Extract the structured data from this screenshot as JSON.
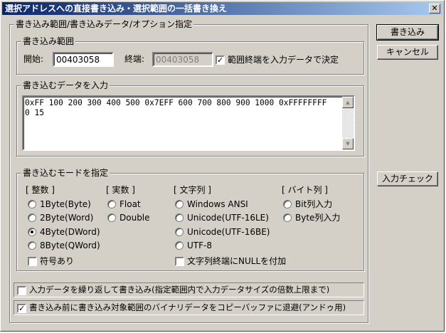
{
  "window": {
    "title": "選択アドレスへの直接書き込み・選択範囲の一括書き換え",
    "close_glyph": "✕"
  },
  "outer_group": {
    "legend": "書き込み範囲/書き込みデータ/オプション指定"
  },
  "range": {
    "legend": "書き込み範囲",
    "start_label": "開始:",
    "start_value": "00403058",
    "end_label": "終端:",
    "end_value": "00403058",
    "auto_end_checked": true,
    "auto_end_label": "範囲終端を入力データで決定"
  },
  "data_input": {
    "legend": "書き込むデータを入力",
    "text": "0xFF 100 200 300 400 500 0x7EFF 600 700 800 900 1000 0xFFFFFFFF\n0 15"
  },
  "mode": {
    "legend": "書き込むモードを指定",
    "integer": {
      "header": "[ 整数 ]",
      "options": [
        "1Byte(Byte)",
        "2Byte(Word)",
        "4Byte(DWord)",
        "8Byte(QWord)"
      ],
      "selected": 2,
      "signed_label": "符号あり",
      "signed_checked": false
    },
    "real": {
      "header": "[ 実数 ]",
      "options": [
        "Float",
        "Double"
      ]
    },
    "string": {
      "header": "[ 文字列 ]",
      "options": [
        "Windows ANSI",
        "Unicode(UTF-16LE)",
        "Unicode(UTF-16BE)",
        "UTF-8"
      ],
      "null_label": "文字列終端にNULLを付加",
      "null_checked": false
    },
    "bytes": {
      "header": "[ バイト列 ]",
      "options": [
        "Bit列入力",
        "Byte列入力"
      ]
    }
  },
  "options": {
    "repeat_label": "入力データを繰り返して書き込み(指定範囲内で入力データサイズの倍数上限まで)",
    "repeat_checked": false,
    "backup_label": "書き込み前に書き込み対象範囲のバイナリデータをコピーバッファに退避(アンドゥ用)",
    "backup_checked": true
  },
  "buttons": {
    "write": "書き込み",
    "cancel": "キャンセル",
    "check": "入力チェック"
  },
  "icons": {
    "check_mark": "✓",
    "scroll_up": "▲",
    "scroll_down": "▼"
  }
}
